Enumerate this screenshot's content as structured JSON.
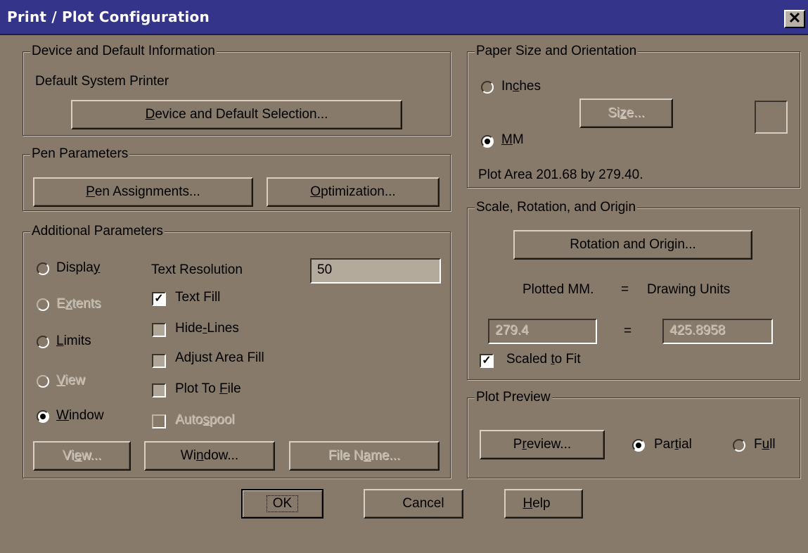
{
  "window": {
    "title": "Print / Plot Configuration",
    "close_glyph": "✕"
  },
  "device": {
    "legend": "Device and Default Information",
    "printer": "Default System Printer",
    "select_button": {
      "pre": "",
      "key": "D",
      "post": "evice and Default Selection..."
    }
  },
  "pen": {
    "legend": "Pen Parameters",
    "assign_button": {
      "pre": "",
      "key": "P",
      "post": "en Assignments..."
    },
    "optimize_button": {
      "pre": "",
      "key": "O",
      "post": "ptimization..."
    }
  },
  "additional": {
    "legend": "Additional Parameters",
    "radios": [
      {
        "pre": "Displa",
        "key": "y",
        "post": "",
        "selected": false,
        "disabled": false
      },
      {
        "pre": "E",
        "key": "x",
        "post": "tents",
        "selected": false,
        "disabled": true
      },
      {
        "pre": "",
        "key": "L",
        "post": "imits",
        "selected": false,
        "disabled": false
      },
      {
        "pre": "",
        "key": "V",
        "post": "iew",
        "selected": false,
        "disabled": true
      },
      {
        "pre": "",
        "key": "W",
        "post": "indow",
        "selected": true,
        "disabled": false
      }
    ],
    "text_resolution_label": "Text Resolution",
    "text_resolution_value": "50",
    "checks": [
      {
        "pre": "Text Fill",
        "key": "",
        "post": "",
        "checked": true,
        "disabled": false
      },
      {
        "pre": "Hide",
        "key": "-",
        "post": "Lines",
        "checked": false,
        "disabled": false
      },
      {
        "pre": "Adjust Area Fill",
        "key": "",
        "post": "",
        "checked": false,
        "disabled": false
      },
      {
        "pre": "Plot To ",
        "key": "F",
        "post": "ile",
        "checked": false,
        "disabled": false
      },
      {
        "pre": "Auto",
        "key": "s",
        "post": "pool",
        "checked": false,
        "disabled": true
      }
    ],
    "view_button": {
      "pre": "Vi",
      "key": "e",
      "post": "w..."
    },
    "window_button": {
      "pre": "Wi",
      "key": "n",
      "post": "dow..."
    },
    "filename_button": {
      "pre": "File N",
      "key": "a",
      "post": "me..."
    }
  },
  "paper": {
    "legend": "Paper Size and Orientation",
    "inches": {
      "pre": "In",
      "key": "c",
      "post": "hes",
      "selected": false
    },
    "mm": {
      "pre": "",
      "key": "M",
      "post": "M",
      "selected": true
    },
    "size_button": {
      "pre": "Si",
      "key": "z",
      "post": "e..."
    },
    "plot_area": "Plot Area 201.68 by 279.40."
  },
  "scale": {
    "legend": "Scale, Rotation, and Origin",
    "rotation_button": "Rotation and Origin...",
    "plotted_label": "Plotted MM.",
    "equals": "=",
    "drawing_label": "Drawing Units",
    "plotted_value": "279.4",
    "drawing_value": "425.8958",
    "scaled_to_fit": {
      "pre": "Scaled ",
      "key": "t",
      "post": "o Fit",
      "checked": true
    }
  },
  "preview": {
    "legend": "Plot Preview",
    "preview_button": {
      "pre": "P",
      "key": "r",
      "post": "eview..."
    },
    "partial": {
      "pre": "Par",
      "key": "t",
      "post": "ial",
      "selected": true
    },
    "full": {
      "pre": "F",
      "key": "u",
      "post": "ll",
      "selected": false
    }
  },
  "footer": {
    "ok": "OK",
    "cancel": "Cancel",
    "help": {
      "pre": "",
      "key": "H",
      "post": "elp"
    }
  }
}
